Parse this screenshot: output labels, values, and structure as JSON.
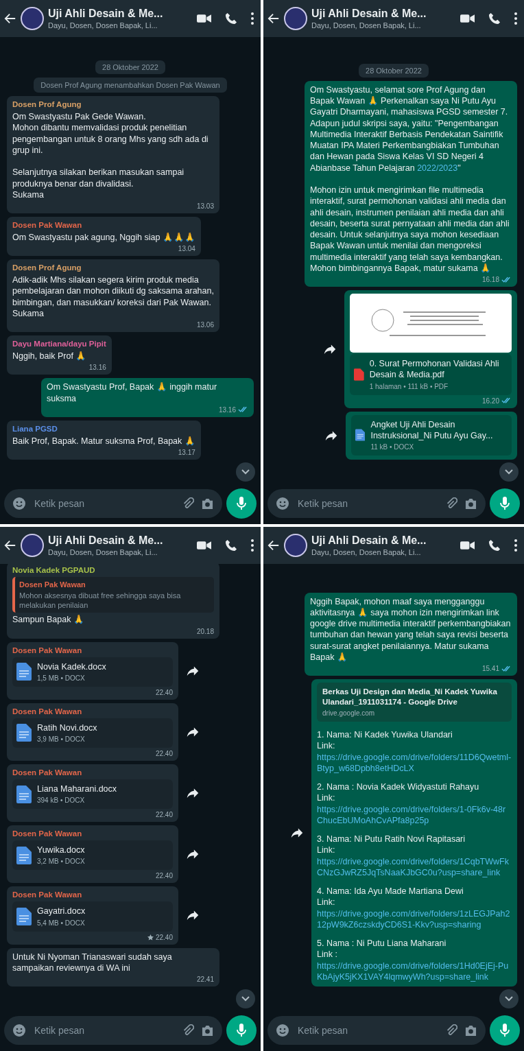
{
  "panels": [
    {
      "header": {
        "title": "Uji Ahli Desain & Me...",
        "subtitle": "Dayu, Dosen, Dosen Bapak, Li..."
      },
      "messages": [
        {
          "kind": "date",
          "text": "28 Oktober 2022"
        },
        {
          "kind": "system",
          "text": "Dosen Prof Agung menambahkan Dosen Pak Wawan"
        },
        {
          "kind": "text",
          "outgoing": false,
          "sender": {
            "name": "Dosen Prof Agung",
            "color": "#d9a066"
          },
          "parts": [
            {
              "kind": "plain",
              "text": "Om Swastyastu Pak Gede Wawan.\nMohon dibantu memvalidasi produk penelitian pengembangan untuk 8 orang Mhs yang sdh ada di grup ini.\n\nSelanjutnya silakan berikan masukan sampai produknya benar dan divalidasi.\nSukama"
            }
          ],
          "time": "13.03"
        },
        {
          "kind": "text",
          "outgoing": false,
          "sender": {
            "name": "Dosen Pak Wawan",
            "color": "#e4664a"
          },
          "parts": [
            {
              "kind": "plain",
              "text": "Om Swastyastu pak agung, Nggih siap 🙏🙏🙏"
            }
          ],
          "time": "13.04"
        },
        {
          "kind": "text",
          "outgoing": false,
          "sender": {
            "name": "Dosen Prof Agung",
            "color": "#d9a066"
          },
          "parts": [
            {
              "kind": "plain",
              "text": "Adik-adik Mhs silakan segera kirim produk media pembelajaran dan mohon diikuti dg saksama arahan, bimbingan, dan masukkan/ koreksi dari Pak Wawan.\nSukama"
            }
          ],
          "time": "13.06"
        },
        {
          "kind": "text",
          "outgoing": false,
          "sender": {
            "name": "Dayu Martiana/dayu Pipit",
            "color": "#e0609a"
          },
          "parts": [
            {
              "kind": "plain",
              "text": "Nggih, baik Prof 🙏"
            }
          ],
          "time": "13.16"
        },
        {
          "kind": "text",
          "outgoing": true,
          "parts": [
            {
              "kind": "plain",
              "text": "Om Swastyastu Prof, Bapak 🙏 inggih matur suksma"
            }
          ],
          "time": "13.16",
          "read": true
        },
        {
          "kind": "text",
          "outgoing": false,
          "sender": {
            "name": "Liana PGSD",
            "color": "#5b8fe8"
          },
          "parts": [
            {
              "kind": "plain",
              "text": "Baik Prof, Bapak. Matur suksma Prof, Bapak 🙏"
            }
          ],
          "time": "13.17"
        }
      ],
      "input": {
        "placeholder": "Ketik pesan"
      }
    },
    {
      "header": {
        "title": "Uji Ahli Desain & Me...",
        "subtitle": "Dayu, Dosen, Dosen Bapak, Li..."
      },
      "messages": [
        {
          "kind": "date",
          "text": "28 Oktober 2022"
        },
        {
          "kind": "text",
          "outgoing": true,
          "parts": [
            {
              "kind": "plain",
              "text": "Om Swastyastu, selamat sore Prof Agung dan Bapak Wawan 🙏 Perkenalkan saya Ni Putu Ayu Gayatri Dharmayani, mahasiswa PGSD semester 7. Adapun judul skripsi saya, yaitu: \"Pengembangan Multimedia Interaktif Berbasis Pendekatan Saintifik Muatan IPA Materi Perkembangbiakan Tumbuhan dan Hewan pada Siswa Kelas VI SD Negeri 4 Abianbase Tahun Pelajaran "
            },
            {
              "kind": "link",
              "text": "2022/2023"
            },
            {
              "kind": "plain",
              "text": "\"\n\nMohon izin untuk mengirimkan file multimedia interaktif, surat permohonan validasi ahli media dan ahli desain, instrumen penilaian ahli media dan ahli desain, beserta surat pernyataan ahli media dan ahli desain. Untuk selanjutnya saya mohon kesediaan Bapak Wawan untuk menilai dan mengoreksi multimedia interaktif yang telah saya kembangkan.\nMohon bimbingannya Bapak, matur sukama 🙏"
            }
          ],
          "time": "16.18",
          "read": true
        },
        {
          "kind": "pdf",
          "outgoing": true,
          "forward": true,
          "name": "0. Surat Permohonan Validasi Ahli Desain & Media.pdf",
          "meta": "1 halaman • 111 kB • PDF",
          "time": "16.20",
          "read": true
        },
        {
          "kind": "file",
          "outgoing": true,
          "forward": true,
          "name": "Angket Uji Ahli Desain Instruksional_Ni Putu Ayu Gay...",
          "meta": "11 kB • DOCX"
        }
      ],
      "input": {
        "placeholder": "Ketik pesan"
      }
    },
    {
      "header": {
        "title": "Uji Ahli Desain & Me...",
        "subtitle": "Dayu, Dosen, Dosen Bapak, Li..."
      },
      "messages": [
        {
          "kind": "text",
          "outgoing": false,
          "sender": {
            "name": "Novia Kadek PGPAUD",
            "color": "#a8c24a"
          },
          "quote": {
            "author": "Dosen Pak Wawan",
            "text": "Mohon aksesnya dibuat free sehingga saya bisa melakukan penilaian"
          },
          "parts": [
            {
              "kind": "plain",
              "text": "Sampun Bapak 🙏"
            }
          ],
          "time": "20.18"
        },
        {
          "kind": "file",
          "outgoing": false,
          "forward": true,
          "sender": {
            "name": "Dosen Pak Wawan",
            "color": "#e4664a"
          },
          "name": "Novia Kadek.docx",
          "meta": "1,5 MB • DOCX",
          "time": "22.40",
          "starred": false
        },
        {
          "kind": "file",
          "outgoing": false,
          "forward": true,
          "sender": {
            "name": "Dosen Pak Wawan",
            "color": "#e4664a"
          },
          "name": "Ratih Novi.docx",
          "meta": "3,9 MB • DOCX",
          "time": "22.40",
          "starred": false
        },
        {
          "kind": "file",
          "outgoing": false,
          "forward": true,
          "sender": {
            "name": "Dosen Pak Wawan",
            "color": "#e4664a"
          },
          "name": "Liana Maharani.docx",
          "meta": "394 kB • DOCX",
          "time": "22.40",
          "starred": false
        },
        {
          "kind": "file",
          "outgoing": false,
          "forward": true,
          "sender": {
            "name": "Dosen Pak Wawan",
            "color": "#e4664a"
          },
          "name": "Yuwika.docx",
          "meta": "3,2 MB • DOCX",
          "time": "22.40",
          "starred": false
        },
        {
          "kind": "file",
          "outgoing": false,
          "forward": true,
          "sender": {
            "name": "Dosen Pak Wawan",
            "color": "#e4664a"
          },
          "name": "Gayatri.docx",
          "meta": "5,4 MB • DOCX",
          "time": "22.40",
          "starred": true
        },
        {
          "kind": "text",
          "outgoing": false,
          "parts": [
            {
              "kind": "plain",
              "text": "Untuk Ni Nyoman Trianaswari sudah saya sampaikan reviewnya di WA ini"
            }
          ],
          "time": "22.41"
        }
      ],
      "input": {
        "placeholder": "Ketik pesan"
      }
    },
    {
      "header": {
        "title": "Uji Ahli Desain & Me...",
        "subtitle": "Dayu, Dosen, Dosen Bapak, Li..."
      },
      "messages": [
        {
          "kind": "text",
          "outgoing": true,
          "parts": [
            {
              "kind": "plain",
              "text": "Nggih Bapak, mohon maaf saya mengganggu aktivitasnya 🙏 saya mohon izin mengirimkan link google drive multimedia interaktif perkembangbiakan tumbuhan dan hewan yang telah saya revisi beserta surat-surat angket penilaiannya. Matur sukama Bapak 🙏"
            }
          ],
          "time": "15.41",
          "read": true
        },
        {
          "kind": "links",
          "outgoing": true,
          "forward": true,
          "preview": {
            "title": "Berkas Uji Design dan Media_Ni Kadek Yuwika Ulandari_1911031174 - Google Drive",
            "domain": "drive.google.com"
          },
          "entries": [
            {
              "label": "1. Nama: Ni Kadek Yuwika Ulandari",
              "link_label": "Link:",
              "url": "https://drive.google.com/drive/folders/11D6Qwetml-Btyp_w68Dpbh8etHDcLX"
            },
            {
              "label": "2. Nama : Novia Kadek Widyastuti Rahayu",
              "link_label": "Link:",
              "url": "https://drive.google.com/drive/folders/1-0Fk6v-48rChucEbUMoAhCvAPfa8p25p"
            },
            {
              "label": "3. Nama: Ni Putu Ratih Novi Rapitasari",
              "link_label": "Link:",
              "url": "https://drive.google.com/drive/folders/1CqbTWwFkCNzGJwRZ5JqTsNaaKJbGC0u?usp=share_link"
            },
            {
              "label": "4. Nama: Ida Ayu Made Martiana Dewi",
              "link_label": "Link:",
              "url": "https://drive.google.com/drive/folders/1zLEGJPah212pW9kZ6czskdyCD6S1-Kkv?usp=sharing"
            },
            {
              "label": "5. Nama : Ni Putu Liana Maharani",
              "link_label": "Link :",
              "url": "https://drive.google.com/drive/folders/1Hd0EjEj-PuKbAjyK5jKX1VAY4lqmwyWh?usp=share_link"
            }
          ]
        }
      ],
      "input": {
        "placeholder": "Ketik pesan"
      }
    }
  ]
}
